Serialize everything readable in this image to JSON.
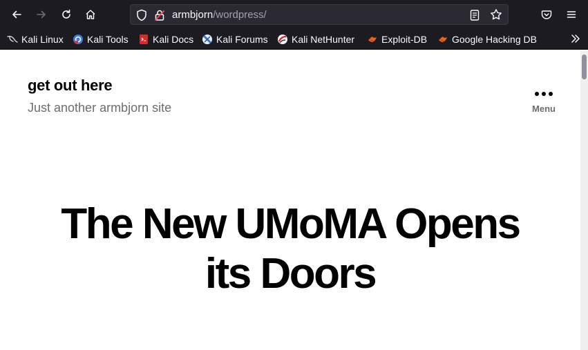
{
  "browser": {
    "url_host": "armbjorn",
    "url_path": "/wordpress/",
    "icons": {
      "back": "back-arrow-icon",
      "forward": "forward-arrow-icon",
      "reload": "reload-icon",
      "home": "home-icon",
      "shield": "shield-icon",
      "lock": "insecure-lock-icon",
      "reader": "reader-view-icon",
      "star": "bookmark-star-icon",
      "pocket": "pocket-icon",
      "menu": "hamburger-menu-icon"
    },
    "colors": {
      "toolbar": "#1c1b22",
      "urlbar": "#2b2a33"
    }
  },
  "bookmarks": [
    {
      "label": "Kali Linux",
      "icon": "kali-dragon-icon"
    },
    {
      "label": "Kali Tools",
      "icon": "kali-tools-icon"
    },
    {
      "label": "Kali Docs",
      "icon": "kali-docs-icon"
    },
    {
      "label": "Kali Forums",
      "icon": "kali-forums-icon"
    },
    {
      "label": "Kali NetHunter",
      "icon": "kali-nethunter-icon"
    },
    {
      "label": "Exploit-DB",
      "icon": "exploit-db-icon"
    },
    {
      "label": "Google Hacking DB",
      "icon": "ghdb-icon"
    }
  ],
  "site": {
    "title": "get out here",
    "description": "Just another armbjorn site",
    "menu_label": "Menu"
  },
  "hero": {
    "line1": "The New UMoMA Opens",
    "line2": "its Doors"
  }
}
